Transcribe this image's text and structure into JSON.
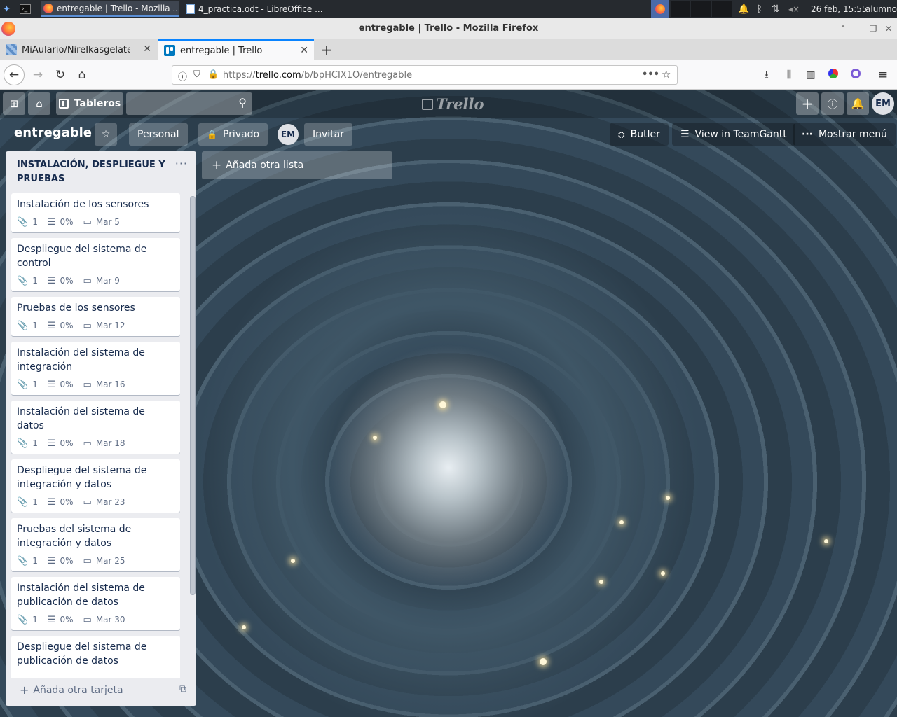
{
  "os": {
    "tasks": [
      {
        "label": "entregable | Trello - Mozilla ..."
      },
      {
        "label": "4_practica.odt - LibreOffice ..."
      }
    ],
    "clock": "26 feb, 15:55",
    "user": "alumno"
  },
  "window": {
    "title": "entregable | Trello - Mozilla Firefox"
  },
  "tabs": [
    {
      "label": "MiAulario/NireIkasgelategia :"
    },
    {
      "label": "entregable | Trello"
    }
  ],
  "nav": {
    "url_prefix": "https://",
    "url_host": "trello.com",
    "url_path": "/b/bpHCIX1O/entregable"
  },
  "trello": {
    "boards_label": "Tableros",
    "logo": "Trello",
    "avatar": "EM"
  },
  "board": {
    "name": "entregable",
    "team": "Personal",
    "visibility": "Privado",
    "invite": "Invitar",
    "butler": "Butler",
    "teamgantt": "View in TeamGantt",
    "menu": "Mostrar menú",
    "add_list": "Añada otra lista"
  },
  "list": {
    "title": "INSTALACIÓN, DESPLIEGUE Y PRUEBAS",
    "add_card": "Añada otra tarjeta",
    "cards": [
      {
        "title": "Instalación de los sensores",
        "attachments": "1",
        "checklist": "0%",
        "due": "Mar 5"
      },
      {
        "title": "Despliegue del sistema de control",
        "attachments": "1",
        "checklist": "0%",
        "due": "Mar 9"
      },
      {
        "title": "Pruebas de los sensores",
        "attachments": "1",
        "checklist": "0%",
        "due": "Mar 12"
      },
      {
        "title": "Instalación del sistema de integración",
        "attachments": "1",
        "checklist": "0%",
        "due": "Mar 16"
      },
      {
        "title": "Instalación del sistema de datos",
        "attachments": "1",
        "checklist": "0%",
        "due": "Mar 18"
      },
      {
        "title": "Despliegue del sistema de integración y datos",
        "attachments": "1",
        "checklist": "0%",
        "due": "Mar 23"
      },
      {
        "title": "Pruebas del sistema de integración y datos",
        "attachments": "1",
        "checklist": "0%",
        "due": "Mar 25"
      },
      {
        "title": "Instalación del sistema de publicación de datos",
        "attachments": "1",
        "checklist": "0%",
        "due": "Mar 30"
      },
      {
        "title": "Despliegue del sistema de publicación de datos",
        "attachments": "",
        "checklist": "",
        "due": ""
      }
    ]
  },
  "icons": {
    "attachment": "paperclip-icon",
    "checklist": "checklist-icon",
    "due": "calendar-icon"
  },
  "colors": {
    "accent": "#0079bf",
    "firefox_tab_accent": "#0a84ff",
    "list_bg": "#ebecf0"
  }
}
